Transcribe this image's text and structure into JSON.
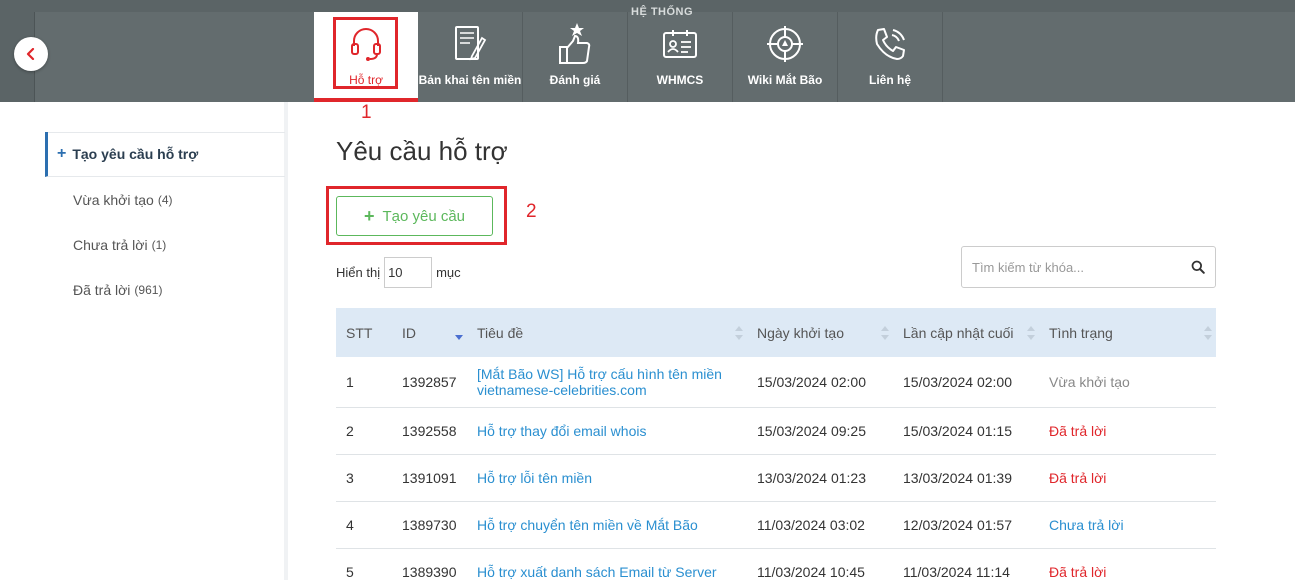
{
  "topbar": {
    "caption": "HỆ THỐNG",
    "nav": [
      {
        "label": "Hỗ trợ",
        "icon": "headset-icon",
        "active": true
      },
      {
        "label": "Bản khai tên miền",
        "icon": "document-pen-icon",
        "active": false
      },
      {
        "label": "Đánh giá",
        "icon": "thumbs-up-star-icon",
        "active": false
      },
      {
        "label": "WHMCS",
        "icon": "id-card-icon",
        "active": false
      },
      {
        "label": "Wiki Mắt Bão",
        "icon": "lifebuoy-icon",
        "active": false
      },
      {
        "label": "Liên hệ",
        "icon": "phone-icon",
        "active": false
      }
    ]
  },
  "annotations": {
    "one": "1",
    "two": "2"
  },
  "sidebar": {
    "create_label": "Tạo yêu cầu hỗ trợ",
    "items": [
      {
        "label": "Vừa khởi tạo",
        "count": "(4)"
      },
      {
        "label": "Chưa trả lời",
        "count": "(1)"
      },
      {
        "label": "Đã trả lời",
        "count": "(961)"
      }
    ]
  },
  "main": {
    "title": "Yêu cầu hỗ trợ",
    "create_button": "Tạo yêu cầu",
    "show_label": "Hiển thị",
    "show_value": "10",
    "show_unit": "mục",
    "search_placeholder": "Tìm kiếm từ khóa..."
  },
  "table": {
    "headers": {
      "stt": "STT",
      "id": "ID",
      "title": "Tiêu đề",
      "created": "Ngày khởi tạo",
      "updated": "Lần cập nhật cuối",
      "status": "Tình trạng"
    },
    "rows": [
      {
        "stt": "1",
        "id": "1392857",
        "title": "[Mắt Bão WS] Hỗ trợ cấu hình tên miền vietnamese-celebrities.com",
        "created": "15/03/2024 02:00",
        "updated": "15/03/2024 02:00",
        "status": "Vừa khởi tạo",
        "status_color": "#888888"
      },
      {
        "stt": "2",
        "id": "1392558",
        "title": "Hỗ trợ thay đổi email whois",
        "created": "15/03/2024 09:25",
        "updated": "15/03/2024 01:15",
        "status": "Đã trả lời",
        "status_color": "#e0262b"
      },
      {
        "stt": "3",
        "id": "1391091",
        "title": "Hỗ trợ lỗi tên miền",
        "created": "13/03/2024 01:23",
        "updated": "13/03/2024 01:39",
        "status": "Đã trả lời",
        "status_color": "#e0262b"
      },
      {
        "stt": "4",
        "id": "1389730",
        "title": "Hỗ trợ chuyển tên miền về Mắt Bão",
        "created": "11/03/2024 03:02",
        "updated": "12/03/2024 01:57",
        "status": "Chưa trả lời",
        "status_color": "#2a8fd0"
      },
      {
        "stt": "5",
        "id": "1389390",
        "title": "Hỗ trợ xuất danh sách Email từ Server",
        "created": "11/03/2024 10:45",
        "updated": "11/03/2024 11:14",
        "status": "Đã trả lời",
        "status_color": "#e0262b"
      }
    ]
  },
  "colors": {
    "accent_red": "#e0262b",
    "link_blue": "#2a8fd0",
    "success_green": "#5cb85c",
    "header_bg": "#5b6466"
  }
}
